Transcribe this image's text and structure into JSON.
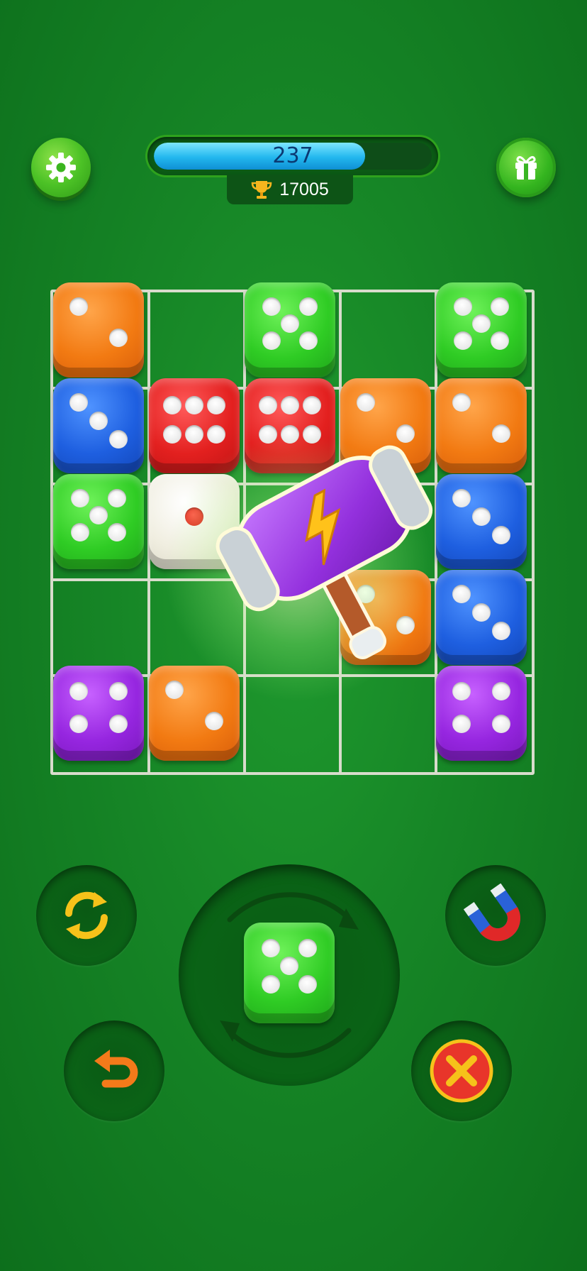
{
  "header": {
    "progress_value": "237",
    "progress_fraction": 0.76,
    "score": "17005",
    "settings_icon": "gear-icon",
    "gift_icon": "gift-icon",
    "trophy_icon": "trophy-icon"
  },
  "board": {
    "columns": 5,
    "rows": 5,
    "cells": [
      {
        "row": 0,
        "col": 0,
        "color": "orange",
        "value": 2
      },
      {
        "row": 0,
        "col": 2,
        "color": "green",
        "value": 5
      },
      {
        "row": 0,
        "col": 4,
        "color": "green",
        "value": 5
      },
      {
        "row": 1,
        "col": 0,
        "color": "blue",
        "value": 3
      },
      {
        "row": 1,
        "col": 1,
        "color": "red",
        "value": 6
      },
      {
        "row": 1,
        "col": 2,
        "color": "red",
        "value": 6
      },
      {
        "row": 1,
        "col": 3,
        "color": "orange",
        "value": 2
      },
      {
        "row": 1,
        "col": 4,
        "color": "orange",
        "value": 2
      },
      {
        "row": 2,
        "col": 0,
        "color": "green",
        "value": 5
      },
      {
        "row": 2,
        "col": 1,
        "color": "white",
        "value": 1
      },
      {
        "row": 2,
        "col": 4,
        "color": "blue",
        "value": 3
      },
      {
        "row": 3,
        "col": 3,
        "color": "orange",
        "value": 2
      },
      {
        "row": 3,
        "col": 4,
        "color": "blue",
        "value": 3
      },
      {
        "row": 4,
        "col": 0,
        "color": "purple",
        "value": 4
      },
      {
        "row": 4,
        "col": 1,
        "color": "orange",
        "value": 2
      },
      {
        "row": 4,
        "col": 4,
        "color": "purple",
        "value": 4
      }
    ]
  },
  "next_die": {
    "color": "green",
    "value": 5
  },
  "controls": {
    "refresh_icon": "refresh-icon",
    "magnet_icon": "magnet-icon",
    "undo_icon": "undo-icon",
    "cancel_icon": "close-icon",
    "hammer_icon": "hammer-icon"
  }
}
